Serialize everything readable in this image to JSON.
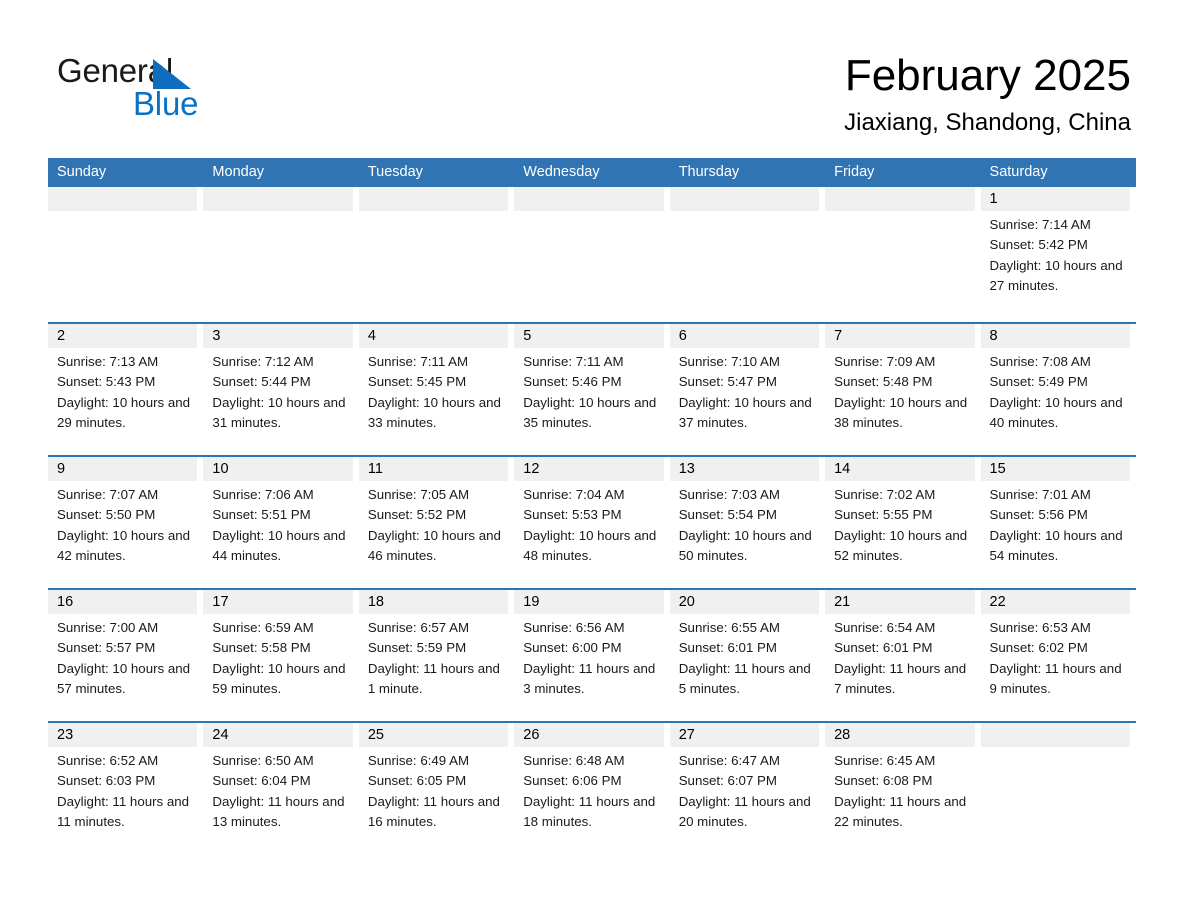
{
  "brand": {
    "name_part1": "General",
    "name_part2": "Blue",
    "triangle_icon": "triangle-icon",
    "accent_color": "#0a72c4"
  },
  "header": {
    "month_title": "February 2025",
    "location": "Jiaxiang, Shandong, China"
  },
  "calendar": {
    "header_color": "#3174b4",
    "day_band_color": "#f0f0f0",
    "weekdays": [
      "Sunday",
      "Monday",
      "Tuesday",
      "Wednesday",
      "Thursday",
      "Friday",
      "Saturday"
    ],
    "weeks": [
      [
        {
          "day": "",
          "sunrise": "",
          "sunset": "",
          "daylight": ""
        },
        {
          "day": "",
          "sunrise": "",
          "sunset": "",
          "daylight": ""
        },
        {
          "day": "",
          "sunrise": "",
          "sunset": "",
          "daylight": ""
        },
        {
          "day": "",
          "sunrise": "",
          "sunset": "",
          "daylight": ""
        },
        {
          "day": "",
          "sunrise": "",
          "sunset": "",
          "daylight": ""
        },
        {
          "day": "",
          "sunrise": "",
          "sunset": "",
          "daylight": ""
        },
        {
          "day": "1",
          "sunrise": "Sunrise: 7:14 AM",
          "sunset": "Sunset: 5:42 PM",
          "daylight": "Daylight: 10 hours and 27 minutes."
        }
      ],
      [
        {
          "day": "2",
          "sunrise": "Sunrise: 7:13 AM",
          "sunset": "Sunset: 5:43 PM",
          "daylight": "Daylight: 10 hours and 29 minutes."
        },
        {
          "day": "3",
          "sunrise": "Sunrise: 7:12 AM",
          "sunset": "Sunset: 5:44 PM",
          "daylight": "Daylight: 10 hours and 31 minutes."
        },
        {
          "day": "4",
          "sunrise": "Sunrise: 7:11 AM",
          "sunset": "Sunset: 5:45 PM",
          "daylight": "Daylight: 10 hours and 33 minutes."
        },
        {
          "day": "5",
          "sunrise": "Sunrise: 7:11 AM",
          "sunset": "Sunset: 5:46 PM",
          "daylight": "Daylight: 10 hours and 35 minutes."
        },
        {
          "day": "6",
          "sunrise": "Sunrise: 7:10 AM",
          "sunset": "Sunset: 5:47 PM",
          "daylight": "Daylight: 10 hours and 37 minutes."
        },
        {
          "day": "7",
          "sunrise": "Sunrise: 7:09 AM",
          "sunset": "Sunset: 5:48 PM",
          "daylight": "Daylight: 10 hours and 38 minutes."
        },
        {
          "day": "8",
          "sunrise": "Sunrise: 7:08 AM",
          "sunset": "Sunset: 5:49 PM",
          "daylight": "Daylight: 10 hours and 40 minutes."
        }
      ],
      [
        {
          "day": "9",
          "sunrise": "Sunrise: 7:07 AM",
          "sunset": "Sunset: 5:50 PM",
          "daylight": "Daylight: 10 hours and 42 minutes."
        },
        {
          "day": "10",
          "sunrise": "Sunrise: 7:06 AM",
          "sunset": "Sunset: 5:51 PM",
          "daylight": "Daylight: 10 hours and 44 minutes."
        },
        {
          "day": "11",
          "sunrise": "Sunrise: 7:05 AM",
          "sunset": "Sunset: 5:52 PM",
          "daylight": "Daylight: 10 hours and 46 minutes."
        },
        {
          "day": "12",
          "sunrise": "Sunrise: 7:04 AM",
          "sunset": "Sunset: 5:53 PM",
          "daylight": "Daylight: 10 hours and 48 minutes."
        },
        {
          "day": "13",
          "sunrise": "Sunrise: 7:03 AM",
          "sunset": "Sunset: 5:54 PM",
          "daylight": "Daylight: 10 hours and 50 minutes."
        },
        {
          "day": "14",
          "sunrise": "Sunrise: 7:02 AM",
          "sunset": "Sunset: 5:55 PM",
          "daylight": "Daylight: 10 hours and 52 minutes."
        },
        {
          "day": "15",
          "sunrise": "Sunrise: 7:01 AM",
          "sunset": "Sunset: 5:56 PM",
          "daylight": "Daylight: 10 hours and 54 minutes."
        }
      ],
      [
        {
          "day": "16",
          "sunrise": "Sunrise: 7:00 AM",
          "sunset": "Sunset: 5:57 PM",
          "daylight": "Daylight: 10 hours and 57 minutes."
        },
        {
          "day": "17",
          "sunrise": "Sunrise: 6:59 AM",
          "sunset": "Sunset: 5:58 PM",
          "daylight": "Daylight: 10 hours and 59 minutes."
        },
        {
          "day": "18",
          "sunrise": "Sunrise: 6:57 AM",
          "sunset": "Sunset: 5:59 PM",
          "daylight": "Daylight: 11 hours and 1 minute."
        },
        {
          "day": "19",
          "sunrise": "Sunrise: 6:56 AM",
          "sunset": "Sunset: 6:00 PM",
          "daylight": "Daylight: 11 hours and 3 minutes."
        },
        {
          "day": "20",
          "sunrise": "Sunrise: 6:55 AM",
          "sunset": "Sunset: 6:01 PM",
          "daylight": "Daylight: 11 hours and 5 minutes."
        },
        {
          "day": "21",
          "sunrise": "Sunrise: 6:54 AM",
          "sunset": "Sunset: 6:01 PM",
          "daylight": "Daylight: 11 hours and 7 minutes."
        },
        {
          "day": "22",
          "sunrise": "Sunrise: 6:53 AM",
          "sunset": "Sunset: 6:02 PM",
          "daylight": "Daylight: 11 hours and 9 minutes."
        }
      ],
      [
        {
          "day": "23",
          "sunrise": "Sunrise: 6:52 AM",
          "sunset": "Sunset: 6:03 PM",
          "daylight": "Daylight: 11 hours and 11 minutes."
        },
        {
          "day": "24",
          "sunrise": "Sunrise: 6:50 AM",
          "sunset": "Sunset: 6:04 PM",
          "daylight": "Daylight: 11 hours and 13 minutes."
        },
        {
          "day": "25",
          "sunrise": "Sunrise: 6:49 AM",
          "sunset": "Sunset: 6:05 PM",
          "daylight": "Daylight: 11 hours and 16 minutes."
        },
        {
          "day": "26",
          "sunrise": "Sunrise: 6:48 AM",
          "sunset": "Sunset: 6:06 PM",
          "daylight": "Daylight: 11 hours and 18 minutes."
        },
        {
          "day": "27",
          "sunrise": "Sunrise: 6:47 AM",
          "sunset": "Sunset: 6:07 PM",
          "daylight": "Daylight: 11 hours and 20 minutes."
        },
        {
          "day": "28",
          "sunrise": "Sunrise: 6:45 AM",
          "sunset": "Sunset: 6:08 PM",
          "daylight": "Daylight: 11 hours and 22 minutes."
        },
        {
          "day": "",
          "sunrise": "",
          "sunset": "",
          "daylight": ""
        }
      ]
    ]
  }
}
